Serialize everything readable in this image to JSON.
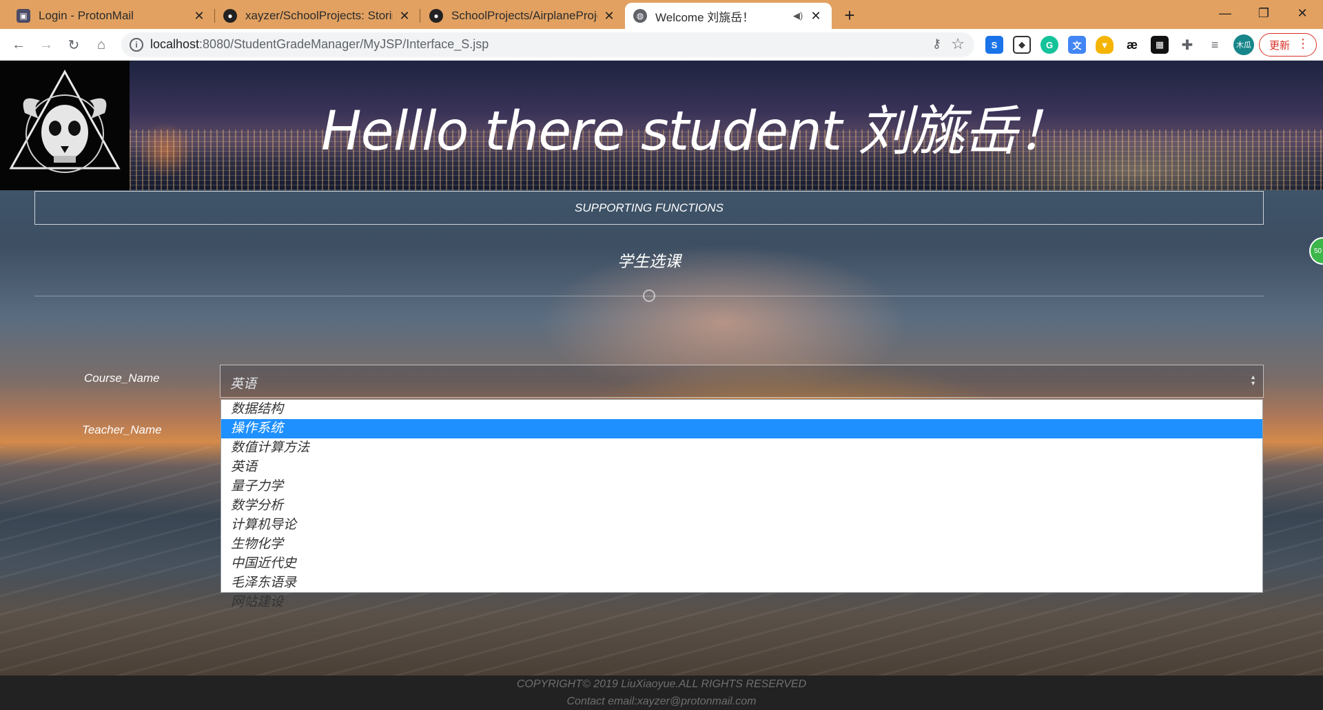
{
  "browser": {
    "tabs": [
      {
        "title": "Login - ProtonMail",
        "icon": "protonmail-icon"
      },
      {
        "title": "xayzer/SchoolProjects: Storing",
        "icon": "github-icon"
      },
      {
        "title": "SchoolProjects/AirplaneProjec",
        "icon": "github-icon"
      },
      {
        "title": "Welcome 刘旐岳！",
        "icon": "globe-icon"
      }
    ],
    "url_host": "localhost",
    "url_path": ":8080/StudentGradeManager/MyJSP/Interface_S.jsp",
    "profile_label": "木瓜",
    "update_label": "更新"
  },
  "page": {
    "headline": "Helllo there student 刘旐岳！",
    "functions_label": "SUPPORTING FUNCTIONS",
    "section_title": "学生选课",
    "side_badge": "50",
    "form": {
      "course_label": "Course_Name",
      "teacher_label": "Teacher_Name",
      "course_selected": "英语",
      "course_options": [
        "数据结构",
        "操作系统",
        "数值计算方法",
        "英语",
        "量子力学",
        "数学分析",
        "计算机导论",
        "生物化学",
        "中国近代史",
        "毛泽东语录",
        "网站建设"
      ],
      "highlighted_option": "操作系统"
    },
    "footer": {
      "copyright": "COPYRIGHT© 2019 LiuXiaoyue.ALL RIGHTS RESERVED",
      "contact": "Contact email:xayzer@protonmail.com"
    }
  },
  "colors": {
    "tabbar": "#e2a161",
    "highlight": "#1e90ff",
    "footer": "#222222"
  }
}
